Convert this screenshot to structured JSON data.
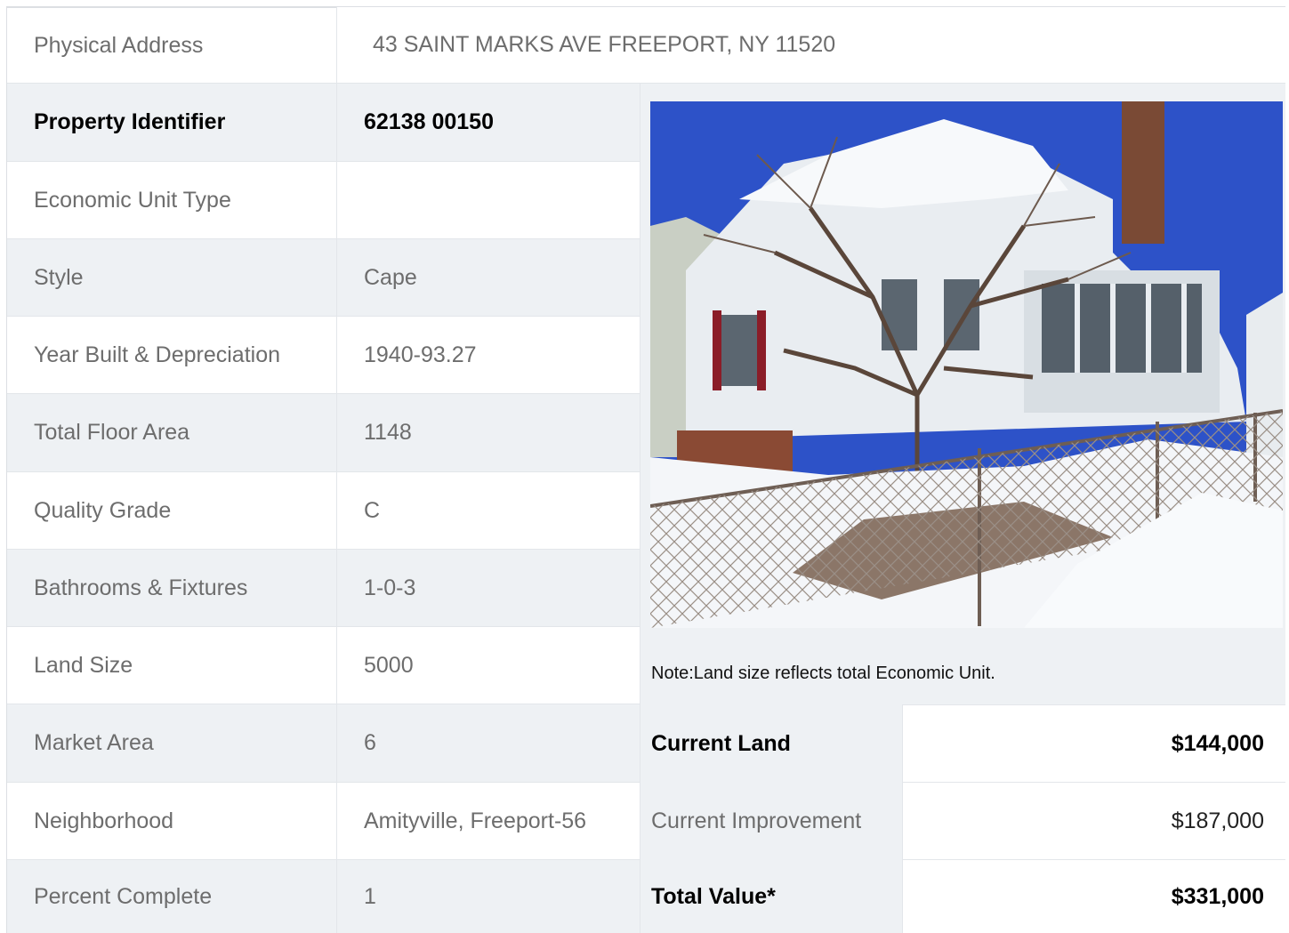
{
  "address": {
    "label": "Physical Address",
    "value": "43  SAINT MARKS AVE  FREEPORT, NY  11520"
  },
  "fields": [
    {
      "label": "Property Identifier",
      "value": "62138  00150"
    },
    {
      "label": "Economic Unit Type",
      "value": ""
    },
    {
      "label": "Style",
      "value": "Cape"
    },
    {
      "label": "Year Built & Depreciation",
      "value": "1940-93.27"
    },
    {
      "label": "Total Floor Area",
      "value": "1148"
    },
    {
      "label": "Quality Grade",
      "value": "C"
    },
    {
      "label": "Bathrooms & Fixtures",
      "value": "1-0-3"
    },
    {
      "label": "Land Size",
      "value": "5000"
    },
    {
      "label": "Market Area",
      "value": "6"
    },
    {
      "label": "Neighborhood",
      "value": "Amityville, Freeport-56"
    },
    {
      "label": "Percent Complete",
      "value": "1"
    }
  ],
  "note": "Note:Land size reflects total Economic Unit.",
  "values": [
    {
      "label": "Current Land",
      "value": "$144,000"
    },
    {
      "label": "Current Improvement",
      "value": "$187,000"
    },
    {
      "label": "Total Value*",
      "value": "$331,000"
    }
  ],
  "colors": {
    "row_gray": "#eef1f4",
    "text_gray": "#6d6d6d",
    "text_bold": "#000000"
  }
}
